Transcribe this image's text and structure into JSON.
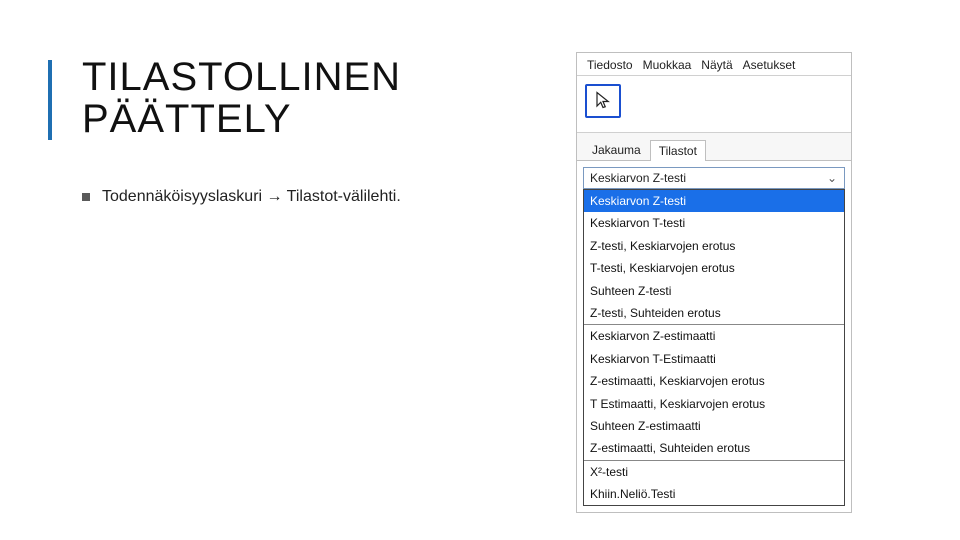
{
  "slide": {
    "title_line1": "TILASTOLLINEN",
    "title_line2": "PÄÄTTELY",
    "bullet_text": "Todennäköisyyslaskuri → Tilastot-välilehti."
  },
  "app": {
    "menu": {
      "file": "Tiedosto",
      "edit": "Muokkaa",
      "view": "Näytä",
      "settings": "Asetukset"
    },
    "tabs": {
      "left": "Jakauma",
      "right": "Tilastot"
    },
    "dropdown": {
      "selected": "Keskiarvon Z-testi"
    },
    "options": {
      "group1": [
        "Keskiarvon Z-testi",
        "Keskiarvon T-testi",
        "Z-testi, Keskiarvojen erotus",
        "T-testi, Keskiarvojen erotus",
        "Suhteen Z-testi",
        "Z-testi, Suhteiden erotus"
      ],
      "group2": [
        "Keskiarvon Z-estimaatti",
        "Keskiarvon T-Estimaatti",
        "Z-estimaatti, Keskiarvojen erotus",
        "T Estimaatti, Keskiarvojen erotus",
        "Suhteen Z-estimaatti",
        "Z-estimaatti, Suhteiden erotus"
      ],
      "group3": [
        "X²-testi",
        "Khiin.Neliö.Testi"
      ]
    }
  }
}
